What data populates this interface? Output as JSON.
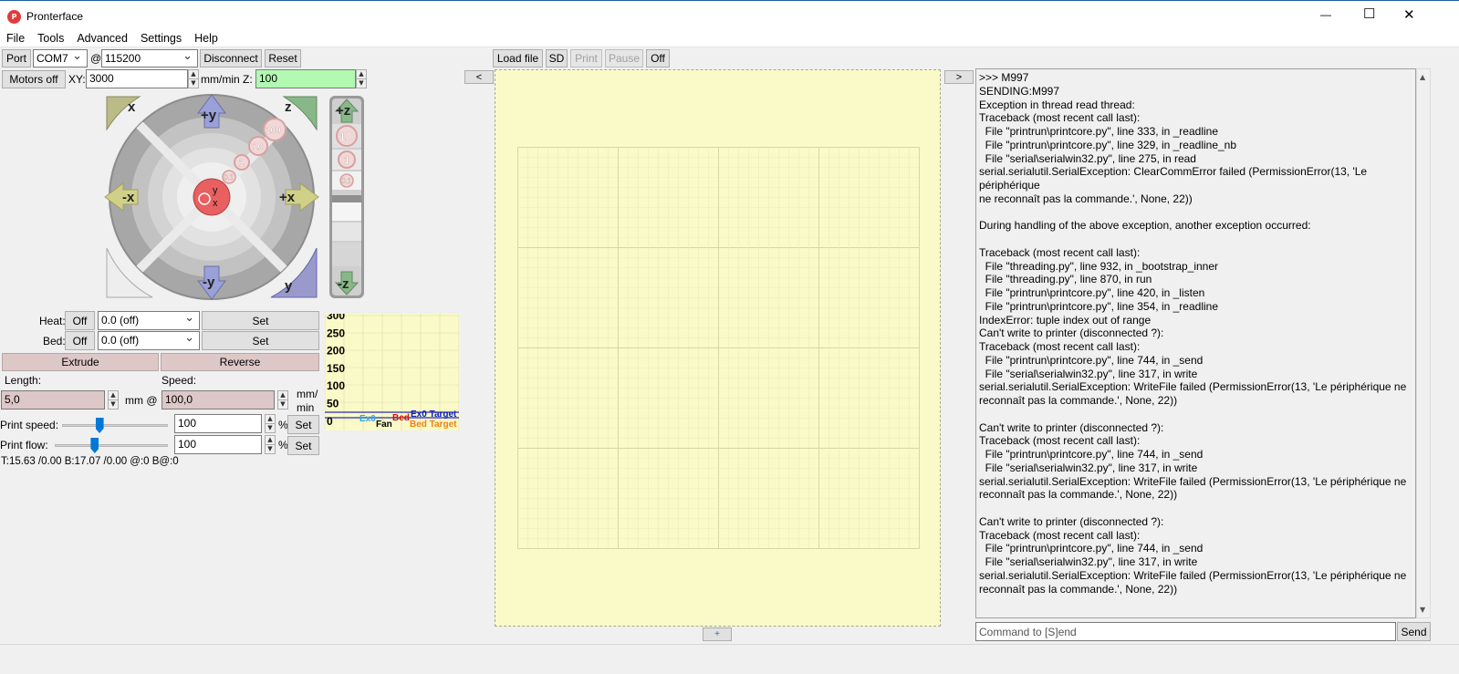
{
  "window": {
    "title": "Pronterface",
    "minimize": "—",
    "maximize": "☐",
    "close": "✕"
  },
  "menu": [
    "File",
    "Tools",
    "Advanced",
    "Settings",
    "Help"
  ],
  "conn": {
    "port_label": "Port",
    "port_value": "COM7",
    "at": "@",
    "baud_value": "115200",
    "disconnect_label": "Disconnect",
    "reset_label": "Reset"
  },
  "motion": {
    "motors_off_label": "Motors off",
    "xy_label": "XY:",
    "xy_value": "3000",
    "mm_min_z_label": "mm/min Z:",
    "z_value": "100"
  },
  "jog": {
    "home_x": "x",
    "home_z": "z",
    "home_y": "y",
    "plus_y": "+y",
    "minus_y": "-y",
    "plus_x": "+x",
    "minus_x": "-x",
    "steps": [
      "100",
      "10",
      "1",
      "0.1"
    ],
    "center_y": "y",
    "center_x": "x",
    "z_plus": "+z",
    "z_minus": "-z",
    "z_steps": [
      "10",
      "1",
      "0.1"
    ]
  },
  "temp": {
    "heat_label": "Heat:",
    "heat_off": "Off",
    "heat_value": "0.0 (off)",
    "heat_set": "Set",
    "bed_label": "Bed:",
    "bed_off": "Off",
    "bed_value": "0.0 (off)",
    "bed_set": "Set"
  },
  "extrude": {
    "extrude_label": "Extrude",
    "reverse_label": "Reverse",
    "length_label": "Length:",
    "speed_label": "Speed:",
    "length_value": "5,0",
    "mm_at": "mm @",
    "speed_value": "100,0",
    "mm_min_1": "mm/",
    "mm_min_2": "min"
  },
  "print_speed": {
    "label": "Print speed:",
    "value": "100",
    "pct": "%",
    "set": "Set",
    "slider": 0.35
  },
  "print_flow": {
    "label": "Print flow:",
    "value": "100",
    "pct": "%",
    "set": "Set",
    "slider": 0.35
  },
  "status_temps": "T:15.63 /0.00 B:17.07 /0.00 @:0 B@:0",
  "graph": {
    "ticks": [
      "300",
      "250",
      "200",
      "150",
      "100",
      "50",
      "0"
    ],
    "legend": {
      "ex0": "Ex0",
      "bed": "Bed",
      "ex0_target": "Ex0 Target",
      "fan": "Fan",
      "bed_target": "Bed Target"
    }
  },
  "toolbar": {
    "load_file": "Load file",
    "sd": "SD",
    "print": "Print",
    "pause": "Pause",
    "off": "Off"
  },
  "collapse_left": "<",
  "collapse_right": ">",
  "plus": "+",
  "colors": {
    "bed_bg": "#fafac8",
    "accent_green": "#b2fab2",
    "pink": "#dec7c7"
  },
  "console_lines": [
    ">>> M997",
    "SENDING:M997",
    "Exception in thread read thread:",
    "Traceback (most recent call last):",
    "  File \"printrun\\printcore.py\", line 333, in _readline",
    "  File \"printrun\\printcore.py\", line 329, in _readline_nb",
    "  File \"serial\\serialwin32.py\", line 275, in read",
    "serial.serialutil.SerialException: ClearCommError failed (PermissionError(13, 'Le périphérique",
    "ne reconnaît pas la commande.', None, 22))",
    "",
    "During handling of the above exception, another exception occurred:",
    "",
    "Traceback (most recent call last):",
    "  File \"threading.py\", line 932, in _bootstrap_inner",
    "  File \"threading.py\", line 870, in run",
    "  File \"printrun\\printcore.py\", line 420, in _listen",
    "  File \"printrun\\printcore.py\", line 354, in _readline",
    "IndexError: tuple index out of range",
    "Can't write to printer (disconnected ?):",
    "Traceback (most recent call last):",
    "  File \"printrun\\printcore.py\", line 744, in _send",
    "  File \"serial\\serialwin32.py\", line 317, in write",
    "serial.serialutil.SerialException: WriteFile failed (PermissionError(13, 'Le périphérique ne",
    "reconnaît pas la commande.', None, 22))",
    "",
    "Can't write to printer (disconnected ?):",
    "Traceback (most recent call last):",
    "  File \"printrun\\printcore.py\", line 744, in _send",
    "  File \"serial\\serialwin32.py\", line 317, in write",
    "serial.serialutil.SerialException: WriteFile failed (PermissionError(13, 'Le périphérique ne",
    "reconnaît pas la commande.', None, 22))",
    "",
    "Can't write to printer (disconnected ?):",
    "Traceback (most recent call last):",
    "  File \"printrun\\printcore.py\", line 744, in _send",
    "  File \"serial\\serialwin32.py\", line 317, in write",
    "serial.serialutil.SerialException: WriteFile failed (PermissionError(13, 'Le périphérique ne",
    "reconnaît pas la commande.', None, 22))"
  ],
  "command": {
    "placeholder": "Command to [S]end",
    "send": "Send"
  }
}
